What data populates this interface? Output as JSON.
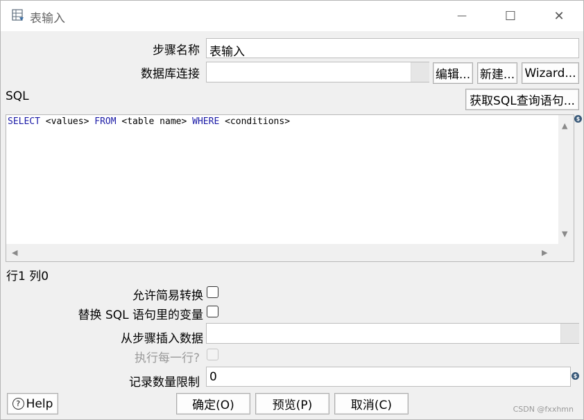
{
  "window": {
    "title": "表输入",
    "controls": {
      "minimize": "—",
      "maximize": "☐",
      "close": "✕"
    }
  },
  "form": {
    "step_name_label": "步骤名称",
    "step_name_value": "表输入",
    "db_conn_label": "数据库连接",
    "db_conn_value": "",
    "edit_btn": "编辑...",
    "new_btn": "新建...",
    "wizard_btn": "Wizard...",
    "sql_label": "SQL",
    "get_sql_btn": "获取SQL查询语句...",
    "sql": {
      "kw1": "SELECT",
      "t1": " <values> ",
      "kw2": "FROM",
      "t2": " <table name> ",
      "kw3": "WHERE",
      "t3": " <conditions>"
    },
    "status_line": "行1 列0",
    "lazy_conversion_label": "允许简易转换",
    "replace_vars_label": "替换 SQL 语句里的变量",
    "insert_from_step_label": "从步骤插入数据",
    "insert_from_step_value": "",
    "execute_each_row_label": "执行每一行?",
    "limit_label": "记录数量限制",
    "limit_value": "0"
  },
  "buttons": {
    "help": "Help",
    "ok": "确定(O)",
    "preview": "预览(P)",
    "cancel": "取消(C)"
  },
  "watermark": "CSDN @fxxhmn"
}
